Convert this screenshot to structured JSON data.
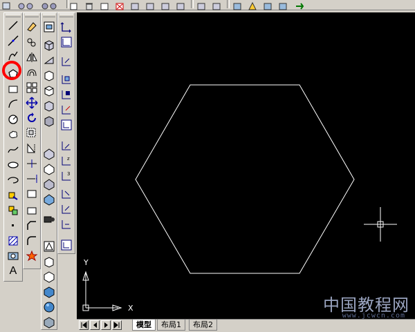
{
  "layout_tabs": [
    {
      "label": "模型",
      "active": true
    },
    {
      "label": "布局1",
      "active": false
    },
    {
      "label": "布局2",
      "active": false
    }
  ],
  "ucs_axes": {
    "x_label": "X",
    "y_label": "Y"
  },
  "watermark": {
    "text": "中国教程网",
    "url": "www.jcwcn.com"
  },
  "draw_toolbar": {
    "selected_tool": "polygon",
    "tools": [
      "line-icon",
      "construction-line-icon",
      "polyline-icon",
      "polygon-icon",
      "rectangle-icon",
      "arc-icon",
      "circle-icon",
      "revision-cloud-icon",
      "spline-icon",
      "ellipse-icon",
      "ellipse-arc-icon",
      "insert-block-icon",
      "make-block-icon",
      "point-icon",
      "hatch-icon",
      "region-icon",
      "multiline-text-icon"
    ],
    "text_tool_glyph": "A"
  },
  "colors": {
    "canvas": "#000000",
    "geometry": "#ffffff",
    "highlight": "#ff0000",
    "chrome": "#d4d0c8"
  }
}
